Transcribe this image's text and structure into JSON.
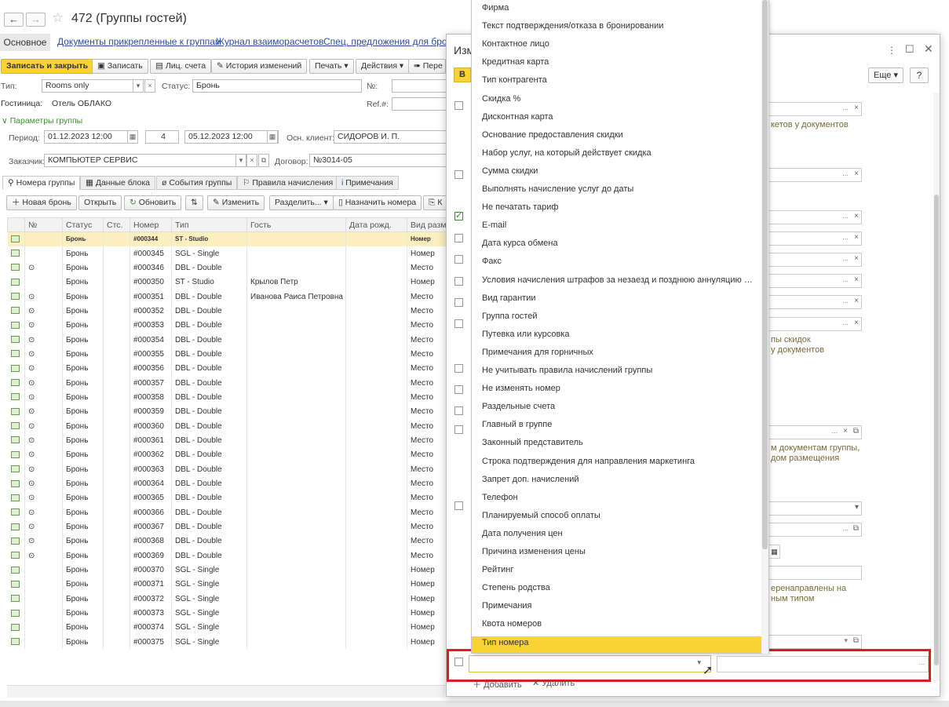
{
  "window": {
    "title": "472 (Группы гостей)",
    "back": "←",
    "forward": "→"
  },
  "tabs": {
    "main": "Основное",
    "links": [
      "Документы прикрепленные к группам",
      "Журнал взаиморасчетов",
      "Спец. предложения для брони"
    ]
  },
  "toolbar": {
    "save_close": "Записать и закрыть",
    "save": "Записать",
    "accounts": "Лиц. счета",
    "history": "История изменений",
    "print": "Печать",
    "actions": "Действия",
    "move": "Пере"
  },
  "form": {
    "type_label": "Тип:",
    "type_value": "Rooms only",
    "status_label": "Статус:",
    "status_value": "Бронь",
    "num_label": "№:",
    "hotel_label": "Гостиница:",
    "hotel_value": "Отель ОБЛАКО",
    "ref_label": "Ref.#:",
    "params_header": "Параметры группы",
    "period_label": "Период:",
    "date_from": "01.12.2023 12:00",
    "nights": "4",
    "date_to": "05.12.2023 12:00",
    "main_client_label": "Осн. клиент:",
    "main_client_value": "СИДОРОВ И. П.",
    "customer_label": "Заказчик:",
    "customer_value": "КОМПЬЮТЕР СЕРВИС",
    "contract_label": "Договор:",
    "contract_value": "№3014-05"
  },
  "page_tabs": [
    "Номера группы",
    "Данные блока",
    "События группы",
    "Правила начисления",
    "Примечания"
  ],
  "table_toolbar": {
    "new_booking": "Новая бронь",
    "open": "Открыть",
    "refresh": "Обновить",
    "edit": "Изменить",
    "split": "Разделить...",
    "assign_room": "Назначить номера",
    "k": "К"
  },
  "table": {
    "headers": [
      "№",
      "Статус",
      "Стс.",
      "Номер",
      "Тип",
      "Гость",
      "Дата рожд.",
      "Вид разм"
    ],
    "rows": [
      [
        "",
        "Бронь",
        "",
        "#000344",
        "ST - Studio",
        "",
        "",
        "Номер"
      ],
      [
        "",
        "Бронь",
        "",
        "#000345",
        "SGL - Single",
        "",
        "",
        "Номер"
      ],
      [
        "⊙",
        "Бронь",
        "",
        "#000346",
        "DBL - Double",
        "",
        "",
        "Место"
      ],
      [
        "",
        "Бронь",
        "",
        "#000350",
        "ST - Studio",
        "Крылов Петр",
        "",
        "Номер"
      ],
      [
        "⊙",
        "Бронь",
        "",
        "#000351",
        "DBL - Double",
        "Иванова Раиса Петровна",
        "",
        "Место"
      ],
      [
        "⊙",
        "Бронь",
        "",
        "#000352",
        "DBL - Double",
        "",
        "",
        "Место"
      ],
      [
        "⊙",
        "Бронь",
        "",
        "#000353",
        "DBL - Double",
        "",
        "",
        "Место"
      ],
      [
        "⊙",
        "Бронь",
        "",
        "#000354",
        "DBL - Double",
        "",
        "",
        "Место"
      ],
      [
        "⊙",
        "Бронь",
        "",
        "#000355",
        "DBL - Double",
        "",
        "",
        "Место"
      ],
      [
        "⊙",
        "Бронь",
        "",
        "#000356",
        "DBL - Double",
        "",
        "",
        "Место"
      ],
      [
        "⊙",
        "Бронь",
        "",
        "#000357",
        "DBL - Double",
        "",
        "",
        "Место"
      ],
      [
        "⊙",
        "Бронь",
        "",
        "#000358",
        "DBL - Double",
        "",
        "",
        "Место"
      ],
      [
        "⊙",
        "Бронь",
        "",
        "#000359",
        "DBL - Double",
        "",
        "",
        "Место"
      ],
      [
        "⊙",
        "Бронь",
        "",
        "#000360",
        "DBL - Double",
        "",
        "",
        "Место"
      ],
      [
        "⊙",
        "Бронь",
        "",
        "#000361",
        "DBL - Double",
        "",
        "",
        "Место"
      ],
      [
        "⊙",
        "Бронь",
        "",
        "#000362",
        "DBL - Double",
        "",
        "",
        "Место"
      ],
      [
        "⊙",
        "Бронь",
        "",
        "#000363",
        "DBL - Double",
        "",
        "",
        "Место"
      ],
      [
        "⊙",
        "Бронь",
        "",
        "#000364",
        "DBL - Double",
        "",
        "",
        "Место"
      ],
      [
        "⊙",
        "Бронь",
        "",
        "#000365",
        "DBL - Double",
        "",
        "",
        "Место"
      ],
      [
        "⊙",
        "Бронь",
        "",
        "#000366",
        "DBL - Double",
        "",
        "",
        "Место"
      ],
      [
        "⊙",
        "Бронь",
        "",
        "#000367",
        "DBL - Double",
        "",
        "",
        "Место"
      ],
      [
        "⊙",
        "Бронь",
        "",
        "#000368",
        "DBL - Double",
        "",
        "",
        "Место"
      ],
      [
        "⊙",
        "Бронь",
        "",
        "#000369",
        "DBL - Double",
        "",
        "",
        "Место"
      ],
      [
        "",
        "Бронь",
        "",
        "#000370",
        "SGL - Single",
        "",
        "",
        "Номер"
      ],
      [
        "",
        "Бронь",
        "",
        "#000371",
        "SGL - Single",
        "",
        "",
        "Номер"
      ],
      [
        "",
        "Бронь",
        "",
        "#000372",
        "SGL - Single",
        "",
        "",
        "Номер"
      ],
      [
        "",
        "Бронь",
        "",
        "#000373",
        "SGL - Single",
        "",
        "",
        "Номер"
      ],
      [
        "",
        "Бронь",
        "",
        "#000374",
        "SGL - Single",
        "",
        "",
        "Номер"
      ],
      [
        "",
        "Бронь",
        "",
        "#000375",
        "SGL - Single",
        "",
        "",
        "Номер"
      ]
    ]
  },
  "dialog": {
    "title": "Изм",
    "more": "Еще",
    "help": "?",
    "yellow_btn": "В",
    "add": "Добавить",
    "delete": "Удалить",
    "right_texts": [
      "кетов у документов",
      "пы скидок",
      "у документов",
      "м документам группы,",
      "дом размещения",
      "еренаправлены на",
      "ным типом"
    ]
  },
  "dropdown": {
    "items": [
      "Фирма",
      "Текст подтверждения/отказа в бронировании",
      "Контактное лицо",
      "Кредитная карта",
      "Тип контрагента",
      "Скидка %",
      "Дисконтная карта",
      "Основание предоставления скидки",
      "Набор услуг, на который действует скидка",
      "Сумма скидки",
      "Выполнять начисление услуг до даты",
      "Не печатать тариф",
      "E-mail",
      "Дата курса обмена",
      "Факс",
      "Условия начисления штрафов за незаезд и позднюю аннуляцию б...",
      "Вид гарантии",
      "Группа гостей",
      "Путевка или курсовка",
      "Примечания для горничных",
      "Не учитывать правила начислений группы",
      "Не изменять номер",
      "Раздельные счета",
      "Главный в группе",
      "Законный представитель",
      "Строка подтверждения для направления маркетинга",
      "Запрет доп. начислений",
      "Телефон",
      "Планируемый способ оплаты",
      "Дата получения цен",
      "Причина изменения цены",
      "Рейтинг",
      "Степень родства",
      "Примечания",
      "Квота номеров",
      "Тип номера"
    ],
    "selected": "Тип номера"
  },
  "colors": {
    "accent": "#f9d333",
    "highlight": "#e01a22",
    "link": "#2b4ea0",
    "green": "#3a8f2e"
  }
}
